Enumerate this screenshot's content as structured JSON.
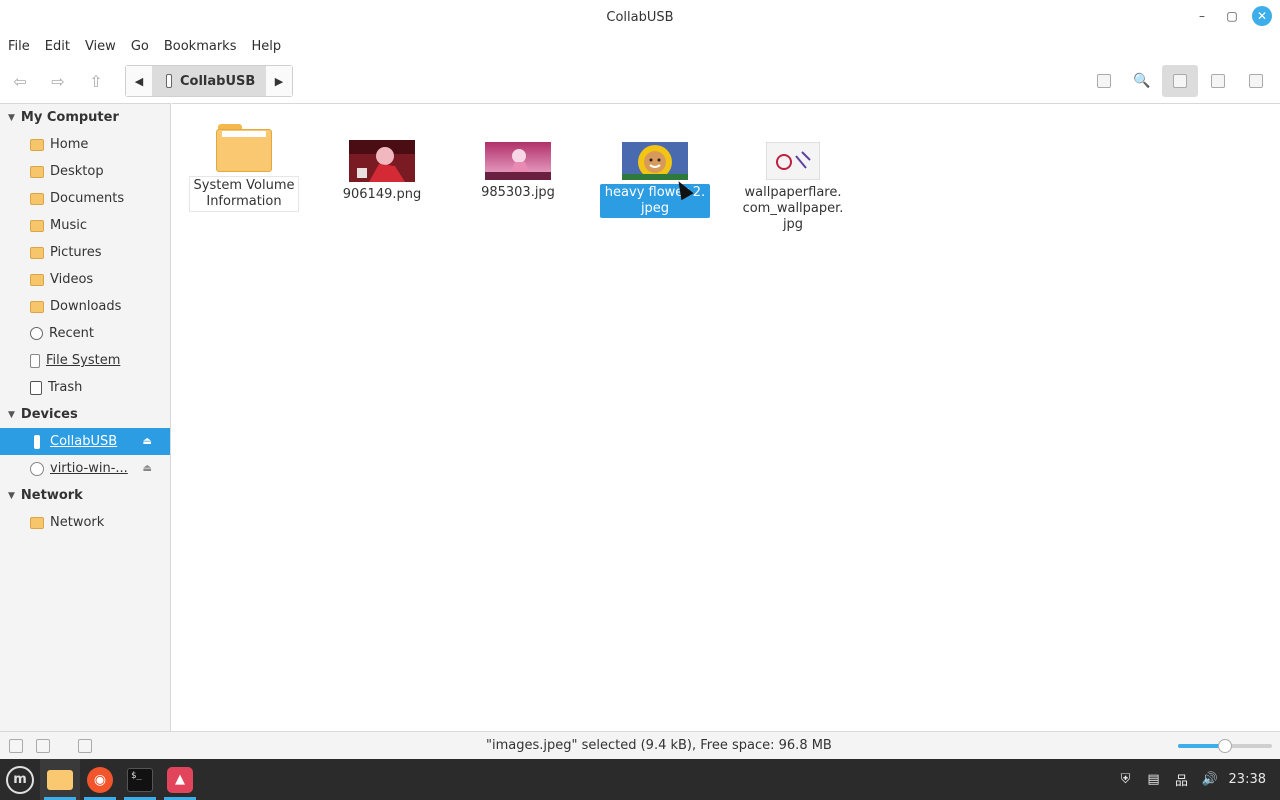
{
  "window": {
    "title": "CollabUSB",
    "minimize_glyph": "–",
    "maximize_glyph": "▢",
    "close_glyph": "✕"
  },
  "menubar": {
    "items": [
      "File",
      "Edit",
      "View",
      "Go",
      "Bookmarks",
      "Help"
    ]
  },
  "toolbar": {
    "back_glyph": "⇦",
    "forward_glyph": "⇨",
    "up_glyph": "⇧",
    "path_left_glyph": "◀",
    "path_right_glyph": "▶",
    "breadcrumb": "CollabUSB",
    "search_glyph": "🔍"
  },
  "sidebar": {
    "sections": [
      {
        "title": "My Computer",
        "items": [
          {
            "label": "Home",
            "icon": "home-folder-icon"
          },
          {
            "label": "Desktop",
            "icon": "desktop-folder-icon"
          },
          {
            "label": "Documents",
            "icon": "documents-folder-icon"
          },
          {
            "label": "Music",
            "icon": "music-folder-icon"
          },
          {
            "label": "Pictures",
            "icon": "pictures-folder-icon"
          },
          {
            "label": "Videos",
            "icon": "videos-folder-icon"
          },
          {
            "label": "Downloads",
            "icon": "downloads-folder-icon"
          },
          {
            "label": "Recent",
            "icon": "recent-icon"
          },
          {
            "label": "File System",
            "icon": "drive-icon"
          },
          {
            "label": "Trash",
            "icon": "trash-icon"
          }
        ]
      },
      {
        "title": "Devices",
        "items": [
          {
            "label": "CollabUSB",
            "icon": "usb-drive-icon",
            "selected": true
          },
          {
            "label": "virtio-win-...",
            "icon": "disc-icon"
          }
        ]
      },
      {
        "title": "Network",
        "items": [
          {
            "label": "Network",
            "icon": "network-folder-icon"
          }
        ]
      }
    ],
    "eject_glyph": "⏏"
  },
  "files": [
    {
      "name_lines": [
        "System Volume",
        "Information"
      ],
      "type": "folder"
    },
    {
      "name_lines": [
        "906149.png"
      ],
      "type": "image"
    },
    {
      "name_lines": [
        "985303.jpg"
      ],
      "type": "image"
    },
    {
      "name_lines": [
        "heavy flower 2.",
        "jpeg"
      ],
      "type": "image",
      "selected": true
    },
    {
      "name_lines": [
        "wallpaperflare.",
        "com_wallpaper.",
        "jpg"
      ],
      "type": "image"
    }
  ],
  "statusbar": {
    "text": "\"images.jpeg\" selected (9.4 kB), Free space: 96.8 MB",
    "zoom_level": 0.5
  },
  "taskbar": {
    "menu_glyph": "m",
    "browser_glyph": "◉",
    "terminal_text": "$_",
    "image_viewer_glyph": "▲",
    "clock": "23:38",
    "shield_glyph": "⛨",
    "notes_glyph": "▤",
    "network_glyph": "品",
    "volume_glyph": "🔊"
  },
  "colors": {
    "accent": "#2d9de3",
    "folder": "#f9c870",
    "taskbar_bg": "#2b2b2b"
  }
}
